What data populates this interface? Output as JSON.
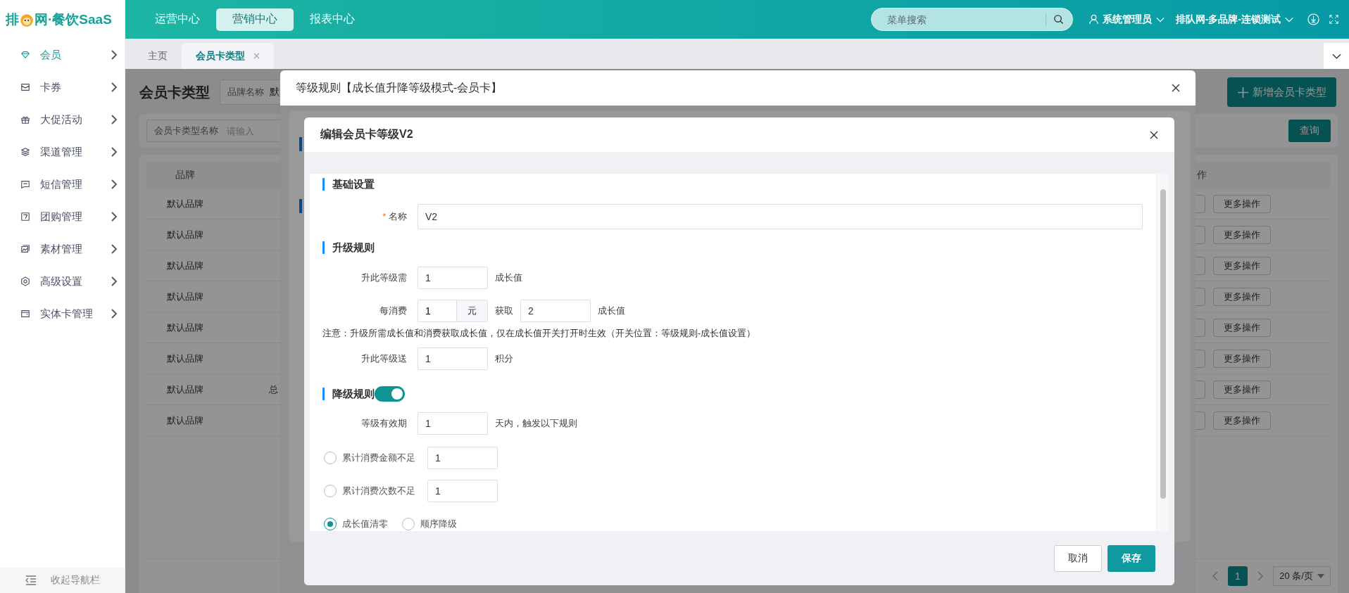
{
  "logo": {
    "text_before": "排",
    "text_after": "网·餐饮SaaS"
  },
  "top_nav": [
    {
      "label": "运营中心",
      "selected": false
    },
    {
      "label": "营销中心",
      "selected": true
    },
    {
      "label": "报表中心",
      "selected": false
    }
  ],
  "menu_search": {
    "placeholder": "菜单搜索"
  },
  "user": "系统管理员",
  "organization": "排队网-多品牌-连锁测试",
  "sidebar": {
    "items": [
      {
        "label": "会员",
        "selected": true
      },
      {
        "label": "卡券",
        "selected": false
      },
      {
        "label": "大促活动",
        "selected": false
      },
      {
        "label": "渠道管理",
        "selected": false
      },
      {
        "label": "短信管理",
        "selected": false
      },
      {
        "label": "团购管理",
        "selected": false
      },
      {
        "label": "素材管理",
        "selected": false
      },
      {
        "label": "高级设置",
        "selected": false
      },
      {
        "label": "实体卡管理",
        "selected": false
      }
    ],
    "collapse": "收起导航栏"
  },
  "tabs": [
    {
      "label": "主页",
      "selected": false
    },
    {
      "label": "会员卡类型",
      "selected": true
    }
  ],
  "page": {
    "title": "会员卡类型",
    "brand_filter": {
      "label": "品牌名称",
      "value": "默"
    },
    "add_button": "新增会员卡类型",
    "name_filter": {
      "label": "会员卡类型名称",
      "placeholder": "请输入"
    },
    "query_button": "查询",
    "table": {
      "columns": {
        "brand": "品牌",
        "actions": "作"
      },
      "rows": [
        {
          "brand": "默认品牌",
          "more": "更多操作"
        },
        {
          "brand": "默认品牌",
          "more": "更多操作"
        },
        {
          "brand": "默认品牌",
          "more": "更多操作"
        },
        {
          "brand": "默认品牌",
          "more": "更多操作"
        },
        {
          "brand": "默认品牌",
          "more": "更多操作"
        },
        {
          "brand": "默认品牌",
          "more": "更多操作"
        },
        {
          "brand": "默认品牌",
          "column_2": "总",
          "more": "更多操作"
        },
        {
          "brand": "默认品牌",
          "more": "更多操作"
        }
      ]
    },
    "pagination": {
      "pages": [
        {
          "label": "1",
          "selected": true
        }
      ],
      "page_size": "20 条/页"
    }
  },
  "outer_dialog": {
    "title": "等级规则【成长值升降等级模式-会员卡】"
  },
  "dialog": {
    "title": "编辑会员卡等级V2",
    "basic": {
      "heading": "基础设置",
      "name": {
        "label": "名称",
        "required_mark": "*",
        "value": "V2"
      }
    },
    "upgrade": {
      "heading": "升级规则",
      "required_growth": {
        "label": "升此等级需",
        "value": "1",
        "unit": "成长值"
      },
      "per_spend": {
        "label": "每消费",
        "value": "1",
        "addon": "元",
        "mid": "获取",
        "earn_value": "2",
        "unit": "成长值"
      },
      "note": "注意：升级所需成长值和消费获取成长值，仅在成长值开关打开时生效（开关位置：等级规则-成长值设置）",
      "bonus_points": {
        "label": "升此等级送",
        "value": "1",
        "unit": "积分"
      }
    },
    "downgrade": {
      "heading": "降级规则",
      "enabled": true,
      "validity": {
        "label": "等级有效期",
        "value": "1",
        "unit": "天内，触发以下规则"
      },
      "conditions": [
        {
          "label": "累计消费金额不足",
          "selected": false,
          "value": "1"
        },
        {
          "label": "累计消费次数不足",
          "selected": false,
          "value": "1"
        }
      ],
      "actions": [
        {
          "label": "成长值清零",
          "selected": true
        },
        {
          "label": "顺序降级",
          "selected": false
        }
      ]
    },
    "buttons": {
      "cancel": "取消",
      "save": "保存"
    }
  }
}
